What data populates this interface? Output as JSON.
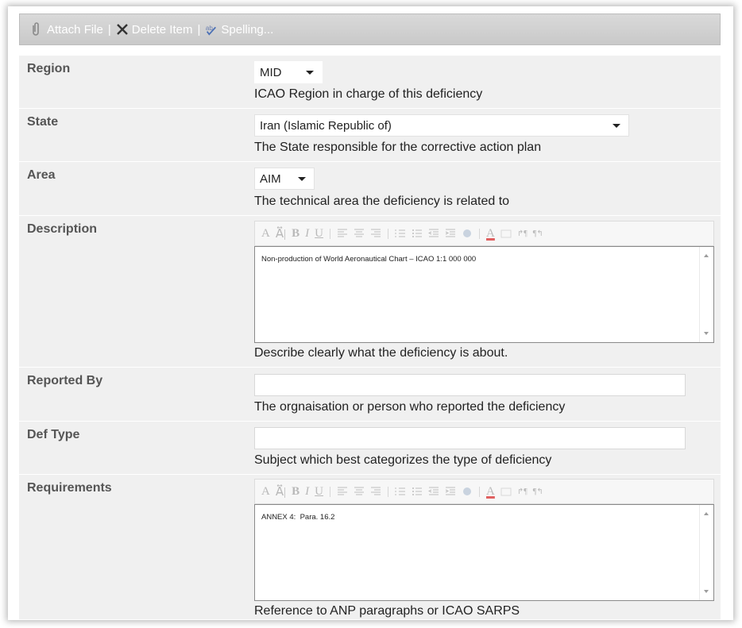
{
  "toolbar": {
    "attach_label": "Attach File",
    "delete_label": "Delete Item",
    "spelling_label": "Spelling...",
    "separator": "|"
  },
  "fields": {
    "region": {
      "label": "Region",
      "value": "MID",
      "hint": "ICAO Region in charge of this deficiency"
    },
    "state": {
      "label": "State",
      "value": "Iran (Islamic Republic of)",
      "hint": "The State responsible for the corrective action plan"
    },
    "area": {
      "label": "Area",
      "value": "AIM",
      "hint": "The technical area the deficiency is related to"
    },
    "description": {
      "label": "Description",
      "value": "Non-production of World Aeronautical Chart – ICAO 1:1 000 000",
      "hint": "Describe clearly what the deficiency is about."
    },
    "reported_by": {
      "label": "Reported By",
      "value": "",
      "hint": "The orgnaisation or person who reported the deficiency"
    },
    "def_type": {
      "label": "Def Type",
      "value": "",
      "hint": "Subject which best categorizes the type of deficiency"
    },
    "requirements": {
      "label": "Requirements",
      "value": "ANNEX 4:  Para. 16.2",
      "hint": "Reference to ANP paragraphs or ICAO SARPS"
    }
  },
  "rte": {
    "font_a": "A",
    "font_size": "A⃡|",
    "bold": "B",
    "italic": "I",
    "underline": "U",
    "pipe": "|",
    "font_color": "A",
    "ltr": "↱¶",
    "rtl": "¶↰"
  },
  "colors": {
    "toolbar_bg": "#cfcfcf",
    "form_bg": "#f0f0f0",
    "label_text": "#555555"
  }
}
